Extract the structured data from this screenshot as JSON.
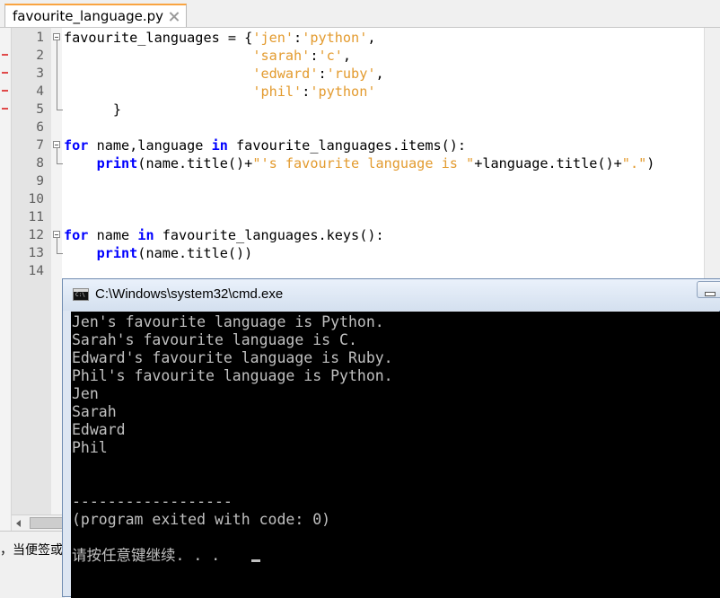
{
  "editor": {
    "tab_label": "favourite_language.py",
    "lines": [
      {
        "num": "1",
        "tokens": [
          {
            "t": "favourite_languages = {"
          },
          {
            "t": "'jen'",
            "c": "str"
          },
          {
            "t": ":"
          },
          {
            "t": "'python'",
            "c": "str"
          },
          {
            "t": ","
          }
        ]
      },
      {
        "num": "2",
        "tokens": [
          {
            "t": "                       "
          },
          {
            "t": "'sarah'",
            "c": "str"
          },
          {
            "t": ":"
          },
          {
            "t": "'c'",
            "c": "str"
          },
          {
            "t": ","
          }
        ]
      },
      {
        "num": "3",
        "tokens": [
          {
            "t": "                       "
          },
          {
            "t": "'edward'",
            "c": "str"
          },
          {
            "t": ":"
          },
          {
            "t": "'ruby'",
            "c": "str"
          },
          {
            "t": ","
          }
        ]
      },
      {
        "num": "4",
        "tokens": [
          {
            "t": "                       "
          },
          {
            "t": "'phil'",
            "c": "str"
          },
          {
            "t": ":"
          },
          {
            "t": "'python'",
            "c": "str"
          }
        ]
      },
      {
        "num": "5",
        "tokens": [
          {
            "t": "      }"
          }
        ]
      },
      {
        "num": "6",
        "tokens": []
      },
      {
        "num": "7",
        "tokens": [
          {
            "t": "for",
            "c": "kw"
          },
          {
            "t": " name,language "
          },
          {
            "t": "in",
            "c": "kw"
          },
          {
            "t": " favourite_languages.items():"
          }
        ]
      },
      {
        "num": "8",
        "tokens": [
          {
            "t": "    "
          },
          {
            "t": "print",
            "c": "kw"
          },
          {
            "t": "(name.title()+"
          },
          {
            "t": "\"'s favourite language is \"",
            "c": "str"
          },
          {
            "t": "+language.title()+"
          },
          {
            "t": "\".\"",
            "c": "str"
          },
          {
            "t": ")"
          }
        ]
      },
      {
        "num": "9",
        "tokens": []
      },
      {
        "num": "10",
        "tokens": []
      },
      {
        "num": "11",
        "tokens": []
      },
      {
        "num": "12",
        "tokens": [
          {
            "t": "for",
            "c": "kw"
          },
          {
            "t": " name "
          },
          {
            "t": "in",
            "c": "kw"
          },
          {
            "t": " favourite_languages.keys():"
          }
        ]
      },
      {
        "num": "13",
        "tokens": [
          {
            "t": "    "
          },
          {
            "t": "print",
            "c": "kw"
          },
          {
            "t": "(name.title())"
          }
        ]
      },
      {
        "num": "14",
        "tokens": []
      }
    ],
    "status_text": "，当便签或"
  },
  "cmd": {
    "title": "C:\\Windows\\system32\\cmd.exe",
    "output": [
      "Jen's favourite language is Python.",
      "Sarah's favourite language is C.",
      "Edward's favourite language is Ruby.",
      "Phil's favourite language is Python.",
      "Jen",
      "Sarah",
      "Edward",
      "Phil",
      "",
      "",
      "------------------",
      "(program exited with code: 0)",
      "",
      "请按任意键继续. . ."
    ]
  },
  "colors": {
    "keyword": "#0000ff",
    "string": "#e39b2f",
    "active_tab_accent": "#f9a441",
    "console_bg": "#000000",
    "console_fg": "#c0c0c0"
  }
}
